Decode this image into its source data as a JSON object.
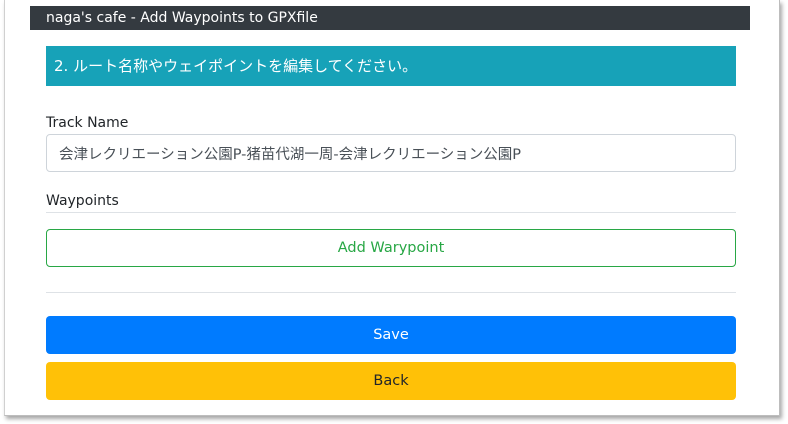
{
  "navbar": {
    "brand": "naga's cafe - Add Waypoints to GPXfile"
  },
  "banner": {
    "text": "2. ルート名称やウェイポイントを編集してください。"
  },
  "form": {
    "track_name_label": "Track Name",
    "track_name_value": "会津レクリエーション公園P-猪苗代湖一周-会津レクリエーション公園P",
    "waypoints_label": "Waypoints",
    "add_waypoint_label": "Add Warypoint",
    "save_label": "Save",
    "back_label": "Back"
  },
  "colors": {
    "navbar": "#343a40",
    "banner": "#17a2b8",
    "add_button": "#28a745",
    "save_button": "#007bff",
    "back_button": "#ffc107"
  }
}
